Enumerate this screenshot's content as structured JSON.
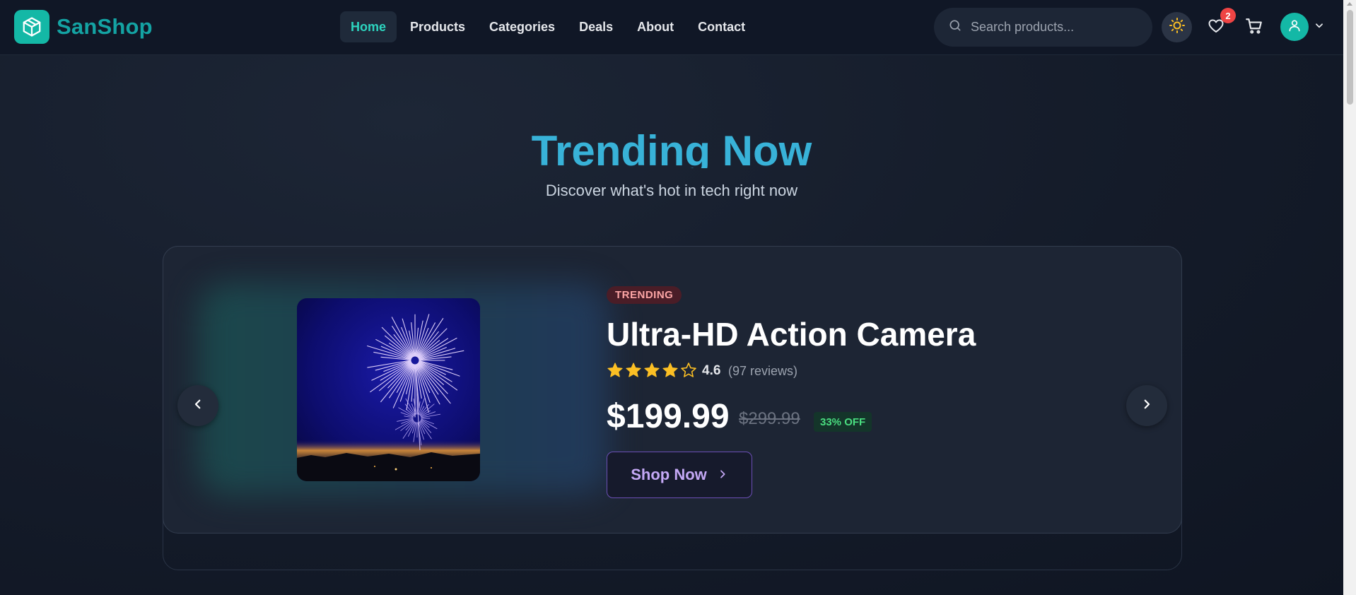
{
  "brand": {
    "name": "SanShop",
    "logo_icon": "cube-icon"
  },
  "nav": {
    "items": [
      {
        "label": "Home",
        "active": true
      },
      {
        "label": "Products",
        "active": false
      },
      {
        "label": "Categories",
        "active": false
      },
      {
        "label": "Deals",
        "active": false
      },
      {
        "label": "About",
        "active": false
      },
      {
        "label": "Contact",
        "active": false
      }
    ]
  },
  "search": {
    "placeholder": "Search products...",
    "value": ""
  },
  "header_actions": {
    "theme_icon": "sun-icon",
    "wishlist_icon": "heart-icon",
    "wishlist_count": "2",
    "cart_icon": "cart-icon",
    "account_icon": "user-icon"
  },
  "hero": {
    "title": "Trending Now",
    "subtitle": "Discover what's hot in tech right now"
  },
  "featured": {
    "badge": "TRENDING",
    "title": "Ultra-HD Action Camera",
    "rating": "4.6",
    "rating_value": 4.6,
    "star_count": 5,
    "reviews": "(97 reviews)",
    "price": "$199.99",
    "old_price": "$299.99",
    "discount": "33% OFF",
    "cta": "Shop Now",
    "image_subject": "fireworks over city at night"
  },
  "colors": {
    "accent": "#14b8a6",
    "title": "#38b2d8",
    "badge_red": "#ef4444",
    "star": "#fbbf24",
    "discount_green": "#4ade80",
    "cta_purple": "#c4a8f5"
  }
}
